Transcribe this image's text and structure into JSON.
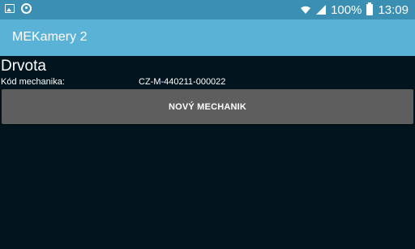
{
  "status_bar": {
    "battery_percent": "100%",
    "time": "13:09",
    "icons": [
      "image-icon",
      "sync-icon",
      "wifi-icon",
      "signal-icon",
      "battery-icon"
    ]
  },
  "app_bar": {
    "title": "MEKamery 2"
  },
  "mechanic": {
    "name": "Drvota",
    "code_label": "Kód mechanika:",
    "code_value": "CZ-M-440211-000022"
  },
  "actions": {
    "new_mechanic_label": "NOVÝ MECHANIK"
  },
  "colors": {
    "status_bar": "#3a8fb2",
    "app_bar": "#5ab2d6",
    "background": "#02151e",
    "button": "#5e5e5e"
  }
}
